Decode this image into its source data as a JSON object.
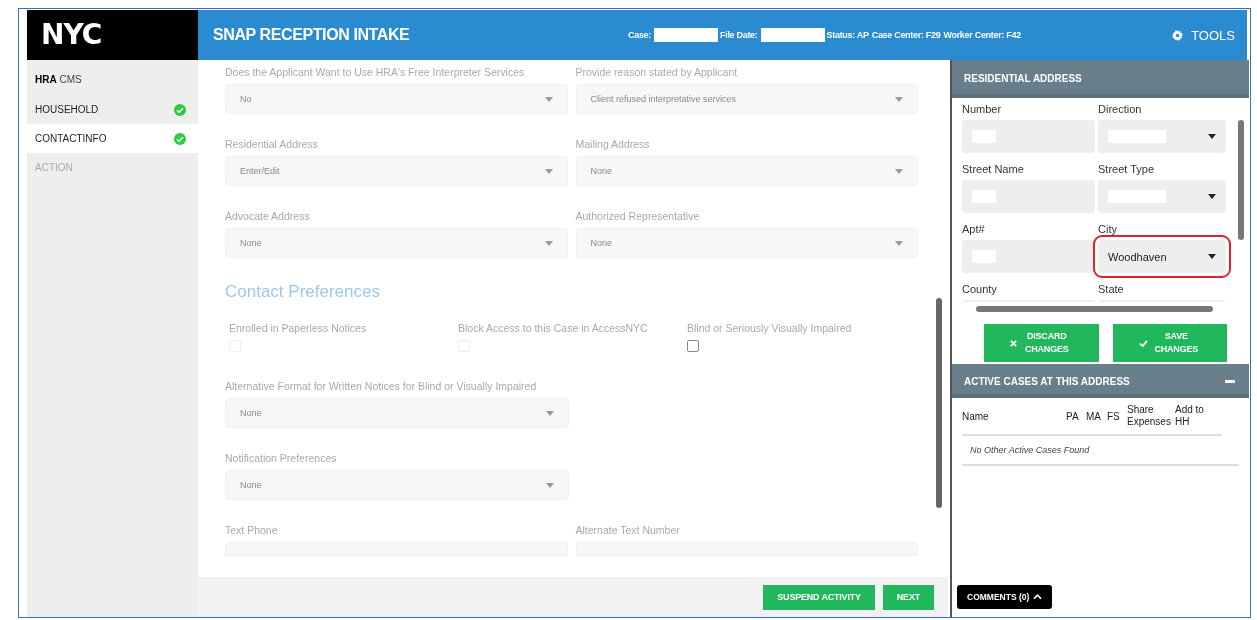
{
  "logo": "NYC",
  "header": {
    "title": "SNAP RECEPTION INTAKE",
    "meta": [
      {
        "label": "Case:",
        "redacted": true
      },
      {
        "label": "File Date:",
        "redacted": true
      },
      {
        "label": "Status: AP",
        "redacted": false
      },
      {
        "label": "Case Center: F29",
        "redacted": false
      },
      {
        "label": "Worker Center: F42",
        "redacted": false
      }
    ],
    "tools": "TOOLS"
  },
  "sidebar": {
    "brand": "**HRA** CMS",
    "items": [
      {
        "label": "HOUSEHOLD",
        "selected": false,
        "complete": true,
        "disabled": false
      },
      {
        "label": "CONTACTINFO",
        "selected": true,
        "complete": true,
        "disabled": false
      },
      {
        "label": "ACTION",
        "selected": false,
        "complete": false,
        "disabled": true
      }
    ]
  },
  "form": {
    "rows": [
      {
        "kind": "fields",
        "fields": [
          {
            "kind": "select",
            "label": "Does the Applicant Want to Use HRA's Free Interpreter Services",
            "value": "No"
          },
          {
            "kind": "select",
            "label": "Provide reason stated by Applicant",
            "value": "Client refused interpretative services"
          }
        ]
      },
      {
        "kind": "fields",
        "fields": [
          {
            "kind": "select",
            "label": "Residential Address",
            "value": "Enter/Edit"
          },
          {
            "kind": "select",
            "label": "Mailing Address",
            "value": "None"
          }
        ]
      },
      {
        "kind": "fields",
        "fields": [
          {
            "kind": "select",
            "label": "Advocate Address",
            "value": "None"
          },
          {
            "kind": "select",
            "label": "Authorized Representative",
            "value": "None"
          }
        ]
      },
      {
        "kind": "heading",
        "text": "Contact Preferences"
      },
      {
        "kind": "checks",
        "items": [
          {
            "label": "Enrolled in Paperless Notices",
            "checked": false,
            "disabled": true
          },
          {
            "label": "Block Access to this Case in AccessNYC",
            "checked": false,
            "disabled": true
          },
          {
            "label": "Blind or Seriously Visually Impaired",
            "checked": false,
            "disabled": false
          }
        ]
      },
      {
        "kind": "fields",
        "fields": [
          {
            "kind": "select",
            "label": "Alternative Format for Written Notices for Blind or Visually Impaired",
            "value": "None"
          }
        ]
      },
      {
        "kind": "fields",
        "fields": [
          {
            "kind": "select",
            "label": "Notification Preferences",
            "value": "None"
          }
        ]
      },
      {
        "kind": "fields",
        "fields": [
          {
            "kind": "input",
            "label": "Text Phone"
          },
          {
            "kind": "input",
            "label": "Alternate Text Number"
          }
        ]
      }
    ]
  },
  "footer_buttons": [
    "SUSPEND ACTIVITY",
    "NEXT"
  ],
  "residential_address": {
    "title": "RESIDENTIAL ADDRESS",
    "fields": [
      {
        "kind": "input",
        "label": "Number",
        "redacted": true,
        "highlighted": false
      },
      {
        "kind": "select",
        "label": "Direction",
        "redacted": true,
        "highlighted": false
      },
      {
        "kind": "input",
        "label": "Street Name",
        "redacted": true,
        "highlighted": false
      },
      {
        "kind": "select",
        "label": "Street Type",
        "redacted": true,
        "highlighted": false
      },
      {
        "kind": "input",
        "label": "Apt#",
        "redacted": true,
        "highlighted": false
      },
      {
        "kind": "select",
        "label": "City",
        "value": "Woodhaven",
        "redacted": false,
        "highlighted": true
      },
      {
        "kind": "input",
        "label": "County",
        "redacted": false,
        "highlighted": false
      },
      {
        "kind": "input",
        "label": "State",
        "redacted": false,
        "highlighted": false
      }
    ],
    "buttons": [
      {
        "kind": "discard",
        "label": "DISCARD CHANGES"
      },
      {
        "kind": "save",
        "label": "SAVE CHANGES"
      }
    ]
  },
  "active_cases": {
    "title": "ACTIVE CASES AT THIS ADDRESS",
    "columns": [
      "Name",
      "PA",
      "MA",
      "FS",
      "Share Expenses",
      "Add to HH"
    ],
    "empty_message": "No Other Active Cases Found"
  },
  "comments_button": "COMMENTS (0)"
}
